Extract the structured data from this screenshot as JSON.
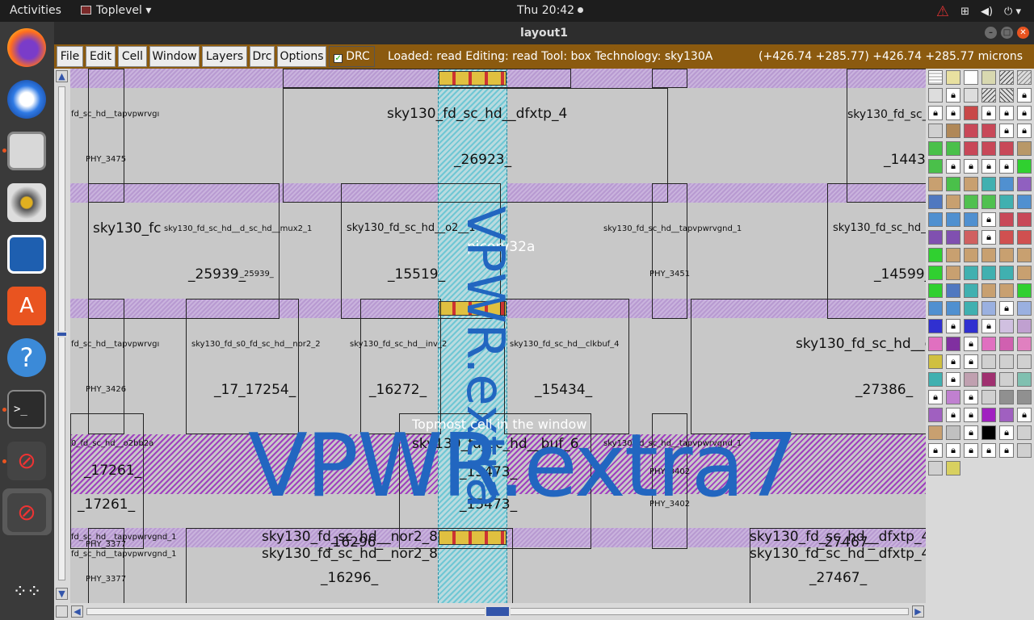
{
  "topbar": {
    "activities": "Activities",
    "app_name": "Toplevel",
    "clock": "Thu 20:42"
  },
  "window": {
    "title": "layout1"
  },
  "menu": {
    "items": [
      "File",
      "Edit",
      "Cell",
      "Window",
      "Layers",
      "Drc",
      "Options"
    ],
    "drc_toggle": "DRC",
    "status": "Loaded: read Editing: read Tool: box  Technology: sky130A",
    "coords": "(+426.74 +285.77) +426.74 +285.77 microns"
  },
  "canvas": {
    "big_label": "VPWR.extra7",
    "vertical_label": "VPWR.extra",
    "topmost_label": "Topmost cell in the window",
    "picorv_label": "picorv32a",
    "cells": [
      {
        "name": "fd_sc_hd__tapvpwrvgı",
        "inst": "PHY_3475"
      },
      {
        "name": "sky130_fd_sc_hd__dfxtp_4",
        "inst": "_26923_"
      },
      {
        "name": "sky130_fd_sc_l",
        "inst": "_1443"
      },
      {
        "name": "sky130_fc",
        "inst": "_25939_"
      },
      {
        "name": "sky130_fd_sc_hd__d_sc_hd__mux2_1",
        "inst": "_25939_"
      },
      {
        "name": "sky130_fd_sc_hd__o2__1",
        "inst": "_15519_"
      },
      {
        "name": "sky130_fd_sc_hd__tapvpwrvgnd_1",
        "inst": "PHY_3451"
      },
      {
        "name": "sky130_fd_sc_hd_",
        "inst": "_14599_"
      },
      {
        "name": "fd_sc_hd__tapvpwrvgı",
        "inst": "PHY_3426"
      },
      {
        "name": "sky130_fd_s0_fd_sc_hd__nor2_2",
        "inst": "_17_17254_"
      },
      {
        "name": "sky130_fd_sc_hd__inv_2",
        "inst": "_16272_"
      },
      {
        "name": "sky130_fd_sc_hd__clkbuf_4",
        "inst": "_15434_"
      },
      {
        "name": "sky130_fd_sc_hd__c",
        "inst": "_27386_"
      },
      {
        "name": "0_fd_sc_hd__o2bb2a",
        "inst": "_17261_"
      },
      {
        "name": "sky130_fd_sc_hd__buf_6",
        "inst": "_15473_"
      },
      {
        "name": "sky130_fd_sc_hd__tapvpwrvgnd_1",
        "inst": "PHY_3402"
      },
      {
        "name": "fd_sc_hd__tapvpwrvgnd_1",
        "inst": "PHY_3377"
      },
      {
        "name": "sky130_fd_sc_hd__nor2_8",
        "inst": "_16296_"
      },
      {
        "name": "sky130_fd_sc_hd__dfxtp_4",
        "inst": "_27467_"
      }
    ]
  }
}
